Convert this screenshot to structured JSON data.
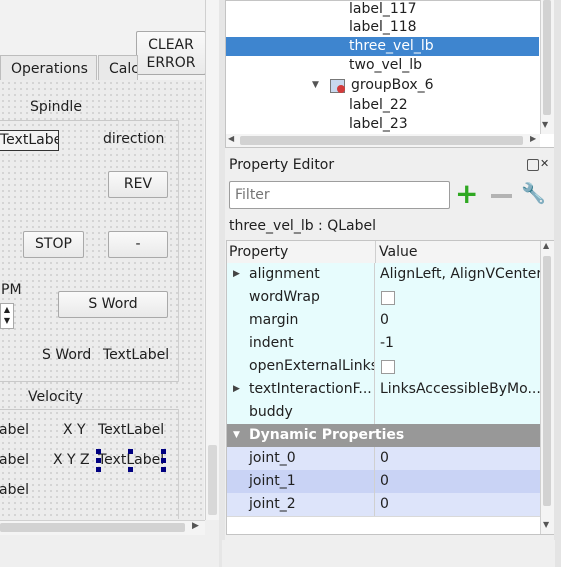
{
  "form": {
    "clear_error_line1": "CLEAR",
    "clear_error_line2": "ERROR",
    "tab_operations": "Operations",
    "tab_calc": "Calc",
    "spindle_title": "Spindle",
    "textlabel_boxed": "TextLabe",
    "direction": "direction",
    "rev_button": "REV",
    "stop_button": "STOP",
    "minus_button": "-",
    "rpm_fragment": "PM",
    "s_word_button": "S Word",
    "s_word_label": "S Word",
    "s_word_value": "TextLabel",
    "velocity_title": "Velocity",
    "label_frag1": "abel",
    "label_frag2": "abel",
    "label_frag3": "abel",
    "xy": "X Y",
    "xy_value": "TextLabel",
    "xyz": "X Y Z",
    "xyz_value": "TextLabel"
  },
  "tree": {
    "items": [
      {
        "label": "label_117"
      },
      {
        "label": "label_118"
      },
      {
        "label": "three_vel_lb"
      },
      {
        "label": "two_vel_lb"
      },
      {
        "label": "groupBox_6"
      },
      {
        "label": "label_22"
      },
      {
        "label": "label_23"
      }
    ]
  },
  "property_editor": {
    "title": "Property Editor",
    "filter_placeholder": "Filter",
    "object_name": "three_vel_lb : QLabel",
    "col_property": "Property",
    "col_value": "Value",
    "rows": [
      {
        "name": "alignment",
        "value": "AlignLeft, AlignVCenter"
      },
      {
        "name": "wordWrap",
        "value": ""
      },
      {
        "name": "margin",
        "value": "0"
      },
      {
        "name": "indent",
        "value": "-1"
      },
      {
        "name": "openExternalLinks",
        "value": ""
      },
      {
        "name": "textInteractionF...",
        "value": "LinksAccessibleByMo..."
      },
      {
        "name": "buddy",
        "value": ""
      }
    ],
    "dynamic_header": "Dynamic Properties",
    "dynamic_rows": [
      {
        "name": "joint_0",
        "value": "0"
      },
      {
        "name": "joint_1",
        "value": "0"
      },
      {
        "name": "joint_2",
        "value": "0"
      }
    ]
  },
  "colors": {
    "selection": "#3e85cf",
    "row_cyan": "#e7fcfd",
    "dynamic_header": "#989898",
    "dynamic_row": "#dde4fa",
    "dynamic_row_alt": "#c9d3f5"
  }
}
